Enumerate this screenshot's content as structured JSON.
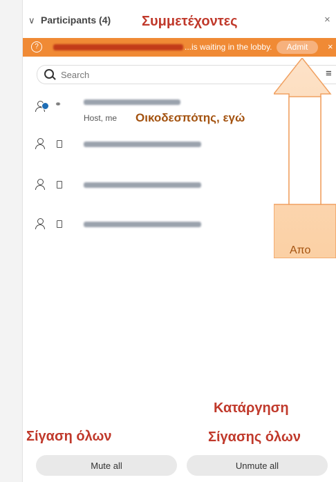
{
  "panel": {
    "title": "Participants (4)",
    "close_symbol": "×",
    "chevron": "∨"
  },
  "annotations": {
    "participants": "Συμμετέχοντες",
    "host_me": "Οικοδεσπότης, εγώ",
    "partial": "Απο",
    "mute_all": "Σίγαση όλων",
    "unmute_all_line1": "Κατάργηση",
    "unmute_all_line2": "Σίγασης όλων",
    "color": "#c0392b",
    "host_color": "#a3520f"
  },
  "lobby": {
    "message": "...is waiting in the lobby.",
    "admit_label": "Admit",
    "close_symbol": "×",
    "icon": "clock-icon",
    "background": "#f08a35"
  },
  "search": {
    "placeholder": "Search"
  },
  "participants": [
    {
      "role": "Host, me",
      "icon": "headset-icon"
    },
    {
      "role": "",
      "icon": "phone-icon"
    },
    {
      "role": "",
      "icon": "phone-icon"
    },
    {
      "role": "",
      "icon": "phone-icon"
    }
  ],
  "footer": {
    "mute_all_label": "Mute all",
    "unmute_all_label": "Unmute all"
  }
}
